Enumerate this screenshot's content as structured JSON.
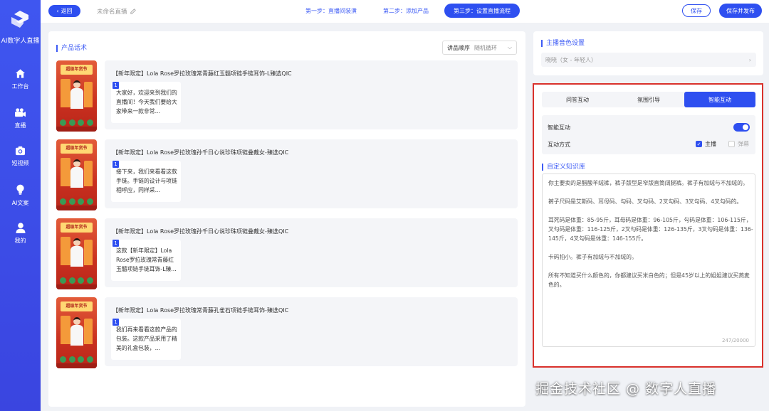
{
  "sidebar": {
    "brand": "AI数字人直播",
    "items": [
      {
        "label": "工作台",
        "icon": "home-icon"
      },
      {
        "label": "直播",
        "icon": "video-camera-icon"
      },
      {
        "label": "短视频",
        "icon": "camera-icon"
      },
      {
        "label": "AI文案",
        "icon": "lightbulb-icon"
      },
      {
        "label": "我的",
        "icon": "user-icon"
      }
    ]
  },
  "topbar": {
    "back_label": "返回",
    "doc_title": "未命名直播",
    "steps": [
      "第一步：直播间装潢",
      "第二步：添加产品",
      "第三步：设置直播流程"
    ],
    "save_label": "保存",
    "publish_label": "保存并发布"
  },
  "left": {
    "section_title": "产品话术",
    "order_label": "讲品顺序",
    "order_value": "随机循环",
    "products": [
      {
        "thumb_banner": "超级年货节",
        "name": "【新年限定】Lola Rose罗拉玫瑰常青藤红玉髓项链手链耳饰-L臻选QIC",
        "index": "1",
        "script": "大家好，欢迎来到我们的直播间！今天我们要给大家带来一款非常..."
      },
      {
        "thumb_banner": "超级年货节",
        "name": "【新年限定】Lola Rose罗拉玫瑰孙千日心说珍珠项链叠戴女-臻选QIC",
        "index": "1",
        "script": "接下来，我们来看看这款手链。手链的设计与项链相呼应，同样采..."
      },
      {
        "thumb_banner": "超级年货节",
        "name": "【新年限定】Lola Rose罗拉玫瑰孙千日心说珍珠项链叠戴女-臻选QIC",
        "index": "1",
        "script": "这款【新年限定】Lola Rose罗拉玫瑰常青藤红玉髓项链手链耳饰-L臻..."
      },
      {
        "thumb_banner": "超级年货节",
        "name": "【新年限定】Lola Rose罗拉玫瑰常青藤孔雀石项链手链耳饰-臻选QIC",
        "index": "1",
        "script": "我们再来看看这款产品的包装。这款产品采用了精美的礼盒包装，..."
      }
    ]
  },
  "right": {
    "voice_title": "主播音色设置",
    "voice_value": "晓晓（女 - 年轻人）",
    "tabs": [
      "问答互动",
      "氛围引导",
      "智能互动"
    ],
    "active_tab": 2,
    "smart_label": "智能互动",
    "smart_enabled": true,
    "mode_label": "互动方式",
    "mode_anchor": "主播",
    "mode_anchor_checked": true,
    "mode_danmaku": "弹幕",
    "mode_danmaku_checked": false,
    "kb_title": "自定义知识库",
    "kb_paragraphs": [
      "你主要卖的是醋酸羊绒裤，裤子版型是窄版直筒阔腿裤。裤子有加绒与不加绒的。",
      "裤子尺码是艾斯码、耳母码、勾码、叉勾码、2叉勾码、3叉勾码、4叉勾码的。",
      "耳死码是体重：85-95斤，耳母码是体重：96-105斤，勾码是体重：106-115斤，叉勾码是体重：116-125斤，2叉勾码是体重：126-135斤，3叉勾码是体重：136-145斤，4叉勾码是体重：146-155斤。",
      "卡码拍小。裤子有加绒与不加绒的。",
      "所有不知道买什么颜色的，你都建议买米白色的；但是45岁以上的姐姐建议买燕麦色的。"
    ],
    "kb_count": "247/20000"
  },
  "watermark": "掘金技术社区 @ 数字人直播",
  "colors": {
    "accent": "#2e4ff0",
    "sidebar": "#3f56f0",
    "highlight_border": "#d9312b"
  }
}
